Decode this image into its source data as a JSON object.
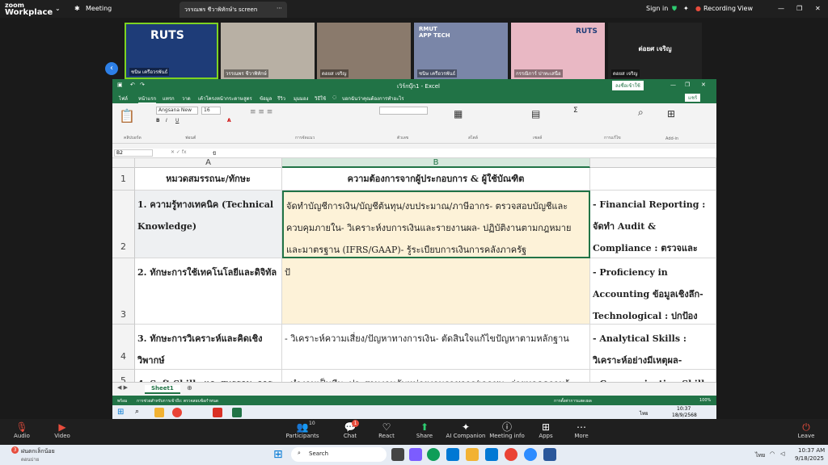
{
  "zoom": {
    "logo_top": "zoom",
    "logo_bottom": "Workplace",
    "meeting_label": "Meeting",
    "share_tab": "วรรณพร ชีวาพิทักษ์'s screen",
    "signin": "Sign in",
    "recording": "Recording",
    "view": "View"
  },
  "gallery": [
    {
      "name": "ชนิษ เครือวรพันธ์"
    },
    {
      "name": "วรรณพร ชีวาพิทักษ์"
    },
    {
      "name": "ดอยส เจริญ"
    },
    {
      "name": "ชนิษ เครือวรพันธ์"
    },
    {
      "name": "กรรณิการ์ ปาทะเสนือ"
    },
    {
      "name": "ดอยส เจริญ",
      "big": "ต่อยศ เจริญ"
    }
  ],
  "excel": {
    "title": "เวิร์กบุ๊ก1 - Excel",
    "signin_btn": "ลงชื่อเข้าใช้",
    "tabs": [
      "ไฟล์",
      "หน้าแรก",
      "แทรก",
      "วาด",
      "เค้าโครงหน้ากระดาษ",
      "สูตร",
      "ข้อมูล",
      "รีวิว",
      "มุมมอง",
      "วิธีใช้",
      "บอกฉันว่าคุณต้องการทำอะไร"
    ],
    "share_btn": "แชร์",
    "font_name": "Angsana New",
    "font_size": "16",
    "groups": [
      "คลิปบอร์ด",
      "ฟอนต์",
      "การจัดแนว",
      "ตัวเลข",
      "สไตล์",
      "เซลล์",
      "การแก้ไข",
      "Add-in"
    ],
    "name_box": "B2",
    "formula": "ปั",
    "columns": [
      "A",
      "B"
    ],
    "rows": [
      {
        "num": "1",
        "a": "หมวดสมรรถนะ/ทักษะ",
        "b": "ความต้องการจากผู้ประกอบการ & ผู้ใช้บัณฑิต",
        "c": ""
      },
      {
        "num": "2",
        "a": "1. ความรู้ทางเทคนิค (Technical Knowledge)",
        "b": "จัดทำบัญชีการเงิน/บัญชีต้นทุน/งบประมาณ/ภาษีอากร- ตรวจสอบบัญชีและควบคุมภายใน- วิเคราะห์งบการเงินและรายงานผล- ปฏิบัติงานตามกฎหมายและมาตรฐาน (IFRS/GAAP)- รู้ระเบียบการเงินการคลังภาครัฐ",
        "c": "- Financial Reporting : จัดทำ Audit & Compliance : ตรวจและควบคุมค่าใช้จ่าย- Forens"
      },
      {
        "num": "3",
        "a": "2. ทักษะการใช้เทคโนโลยีและดิจิทัล",
        "b": "ปั",
        "c": "- Proficiency in Accounting ข้อมูลเชิงลึก- Technological : ปกป้องข้อมูลการเงิน"
      },
      {
        "num": "4",
        "a": "3. ทักษะการวิเคราะห์และคิดเชิงวิพากษ์",
        "b": "- วิเคราะห์ความเสี่ยง/ปัญหาทางการเงิน- ตัดสินใจแก้ไขปัญหาตามหลักฐาน",
        "c": "- Analytical Skills : วิเคราะห์อย่างมีเหตุผล- Problem-Solv"
      },
      {
        "num": "5",
        "a": "4. Soft Skills และสมรรถนะการ",
        "b": "- ทำงานเป็นทีม, ประสานงานกับหน่วยงานราชการ/เอกชน- ถ่ายทอดความรู้",
        "c": "- Communication Skills : สื่"
      }
    ],
    "sheet": "Sheet1",
    "status_left": "พร้อม",
    "status_access": "การช่วยสำหรับการเข้าถึง: ตรวจสอบข้อกำหนด",
    "status_right": "การตั้งค่าการแสดงผล",
    "zoom_level": "100%",
    "time": "10:37",
    "date": "18/9/2568",
    "lang": "ไทย"
  },
  "zoombar": {
    "audio": "Audio",
    "video": "Video",
    "participants": "Participants",
    "participants_count": "10",
    "chat": "Chat",
    "chat_badge": "1",
    "react": "React",
    "share": "Share",
    "ai": "AI Companion",
    "info": "Meeting info",
    "apps": "Apps",
    "more": "More",
    "leave": "Leave"
  },
  "taskbar": {
    "notif_count": "3",
    "notif_title": "ฝนตกเล็กน้อย",
    "notif_sub": "ตอนบ่าย",
    "search": "Search",
    "lang": "ไทย",
    "time": "10:37 AM",
    "date": "9/18/2025"
  }
}
